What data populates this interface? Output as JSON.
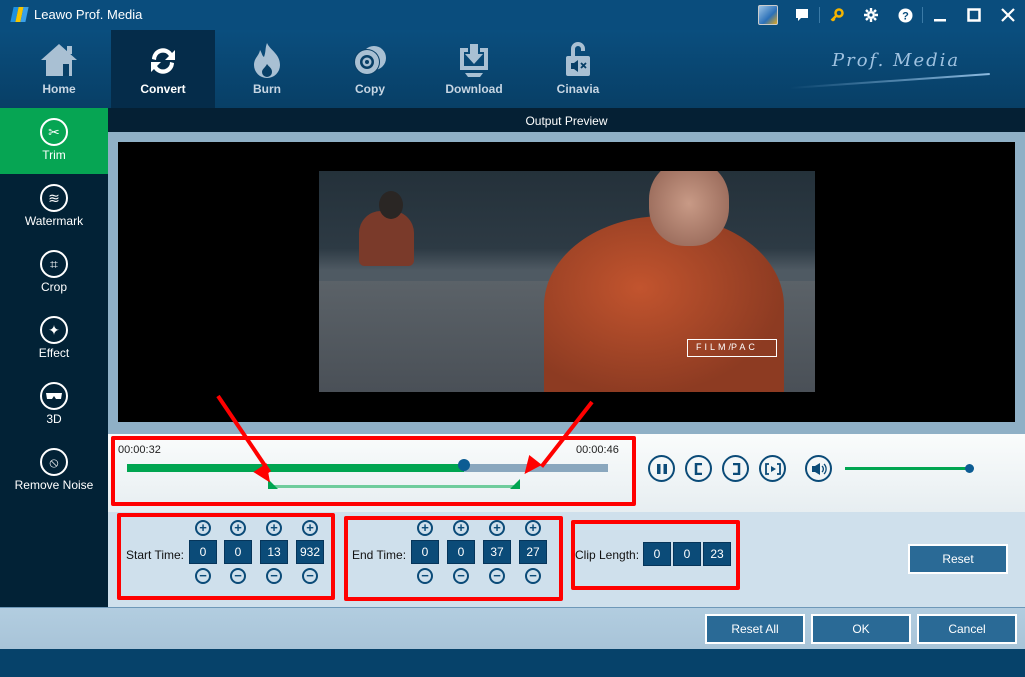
{
  "app": {
    "title": "Leawo Prof. Media",
    "brand_text": "Prof. Media"
  },
  "window_controls": {
    "supports_icon": "supports-badge-icon",
    "feedback_icon": "chat-bubble-icon",
    "register_icon": "key-icon",
    "settings_icon": "gear-icon",
    "help_icon": "question-icon",
    "minimize_glyph": "_",
    "maximize_glyph": "☐",
    "close_glyph": "✕",
    "key_color": "#f5b400"
  },
  "topnav": {
    "items": [
      {
        "label": "Home",
        "icon": "home-icon",
        "glyph": "⌂",
        "active": false
      },
      {
        "label": "Convert",
        "icon": "convert-icon",
        "glyph": "⟳",
        "active": true
      },
      {
        "label": "Burn",
        "icon": "flame-icon",
        "glyph": "🔥",
        "active": false
      },
      {
        "label": "Copy",
        "icon": "disc-icon",
        "glyph": "◎",
        "active": false
      },
      {
        "label": "Download",
        "icon": "download-icon",
        "glyph": "⤓",
        "active": false
      },
      {
        "label": "Cinavia",
        "icon": "unlock-mute-icon",
        "glyph": "🔓",
        "active": false
      }
    ]
  },
  "sidebar": {
    "items": [
      {
        "label": "Trim",
        "icon": "scissors-icon",
        "glyph": "✂",
        "active": true
      },
      {
        "label": "Watermark",
        "icon": "waves-icon",
        "glyph": "≋",
        "active": false
      },
      {
        "label": "Crop",
        "icon": "crop-icon",
        "glyph": "⌗",
        "active": false
      },
      {
        "label": "Effect",
        "icon": "magic-wand-icon",
        "glyph": "✦",
        "active": false
      },
      {
        "label": "3D",
        "icon": "3d-glasses-icon",
        "glyph": "👓",
        "active": false
      },
      {
        "label": "Remove Noise",
        "icon": "noise-off-icon",
        "glyph": "⦸",
        "active": false
      }
    ],
    "active_color": "#06a553"
  },
  "preview": {
    "header": "Output Preview",
    "watermark_left": "FILM",
    "watermark_right": "PAC"
  },
  "timeline": {
    "start_label": "00:00:32",
    "end_label": "00:00:46",
    "playhead_fraction": 0.7,
    "trim_start_fraction": 0.295,
    "trim_end_fraction": 0.815
  },
  "player_controls": {
    "pause": {
      "icon": "pause-icon",
      "glyph": "❚❚"
    },
    "mark_in": {
      "icon": "mark-in-icon",
      "glyph": "["
    },
    "mark_out": {
      "icon": "mark-out-icon",
      "glyph": "]"
    },
    "play_segment": {
      "icon": "play-segment-icon",
      "glyph": "[▶]"
    },
    "volume": {
      "icon": "volume-icon",
      "glyph": "🔊"
    },
    "volume_level": 1.0
  },
  "trim": {
    "start_time": {
      "label": "Start Time:",
      "values": [
        "0",
        "0",
        "13",
        "932"
      ]
    },
    "end_time": {
      "label": "End Time:",
      "values": [
        "0",
        "0",
        "37",
        "27"
      ]
    },
    "clip_length": {
      "label": "Clip Length:",
      "values": [
        "0",
        "0",
        "23"
      ]
    },
    "plus_glyph": "+",
    "minus_glyph": "−",
    "reset_label": "Reset"
  },
  "footer": {
    "reset_all_label": "Reset All",
    "ok_label": "OK",
    "cancel_label": "Cancel"
  },
  "annotations": {
    "color": "#ff0000"
  }
}
